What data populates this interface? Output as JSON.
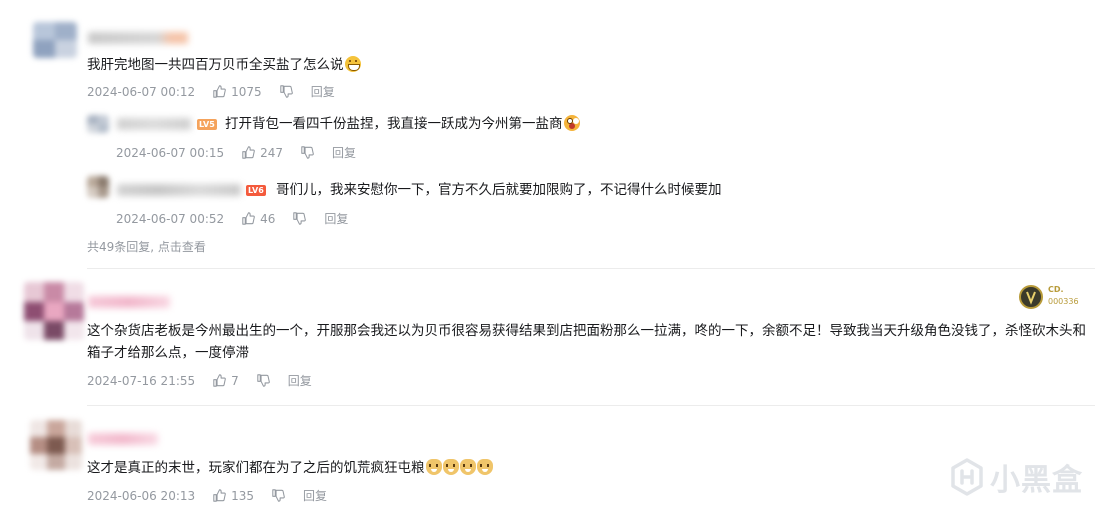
{
  "comments": [
    {
      "text": "我肝完地图一共四百万贝币全买盐了怎么说",
      "emoji": "grin-emoji",
      "time": "2024-06-07 00:12",
      "likes": "1075",
      "reply_label": "回复",
      "replies": [
        {
          "text": "打开背包一看四千份盐捏，我直接一跃成为今州第一盐商",
          "emoji": "shock-emoji",
          "level": "LV5",
          "time": "2024-06-07 00:15",
          "likes": "247",
          "reply_label": "回复"
        },
        {
          "text": "哥们儿，我来安慰你一下，官方不久后就要加限购了，不记得什么时候要加",
          "level": "LV6",
          "time": "2024-06-07 00:52",
          "likes": "46",
          "reply_label": "回复"
        }
      ],
      "more_prefix": "共49条回复, ",
      "more_link": "点击查看"
    },
    {
      "text": "这个杂货店老板是今州最出生的一个，开服那会我还以为贝币很容易获得结果到店把面粉那么一拉满，咚的一下，余额不足！导致我当天升级角色没钱了，杀怪砍木头和箱子才给那么点，一度停滞",
      "medal_text": "CD.",
      "medal_number": "000336",
      "time": "2024-07-16 21:55",
      "likes": "7",
      "reply_label": "回复"
    },
    {
      "text": "这才是真正的末世，玩家们都在为了之后的饥荒疯狂屯粮",
      "emoji_count": 4,
      "time": "2024-06-06 20:13",
      "likes": "135",
      "reply_label": "回复"
    }
  ],
  "watermark": "小黑盒",
  "colors": {
    "text": "#18191c",
    "meta": "#9499a0",
    "divider": "#ececec",
    "level_badge": "#f45a3c"
  }
}
